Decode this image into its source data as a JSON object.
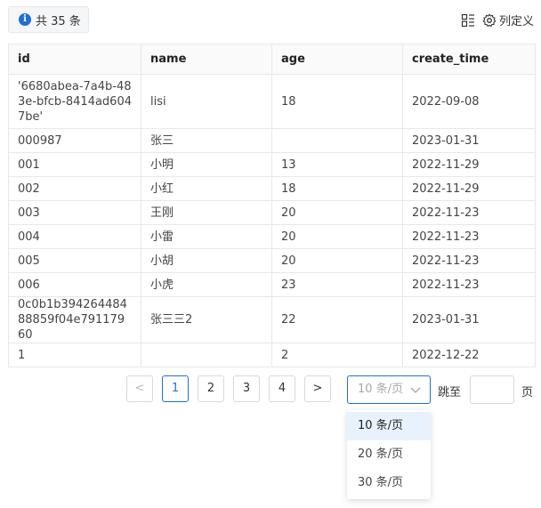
{
  "toolbar": {
    "info_icon_glyph": "i",
    "total_text": "共 35 条",
    "column_settings_label": "列定义"
  },
  "table": {
    "headers": [
      "id",
      "name",
      "age",
      "create_time"
    ],
    "rows": [
      [
        "'6680abea-7a4b-483e-bfcb-8414ad6047be'",
        "lisi",
        "18",
        "2022-09-08"
      ],
      [
        "000987",
        "张三",
        "",
        "2023-01-31"
      ],
      [
        "001",
        "小明",
        "13",
        "2022-11-29"
      ],
      [
        "002",
        "小红",
        "18",
        "2022-11-29"
      ],
      [
        "003",
        "王刚",
        "20",
        "2022-11-23"
      ],
      [
        "004",
        "小雷",
        "20",
        "2022-11-23"
      ],
      [
        "005",
        "小胡",
        "20",
        "2022-11-23"
      ],
      [
        "006",
        "小虎",
        "23",
        "2022-11-23"
      ],
      [
        "0c0b1b39426448488859f04e79117960",
        "张三三2",
        "22",
        "2023-01-31"
      ],
      [
        "1",
        "",
        "2",
        "2022-12-22"
      ]
    ]
  },
  "pagination": {
    "prev_glyph": "<",
    "next_glyph": ">",
    "pages": [
      "1",
      "2",
      "3",
      "4"
    ],
    "current_page": "1",
    "page_size_value": "10 条/页",
    "jump_label": "跳至",
    "jump_value": "",
    "page_unit": "页",
    "page_size_options": [
      "10 条/页",
      "20 条/页",
      "30 条/页"
    ]
  },
  "colors": {
    "accent": "#1f6fd8",
    "border": "#e8e8e8",
    "header_bg": "#fafafa",
    "dropdown_selected_bg": "#e8f2fd"
  },
  "icons": [
    "info-icon",
    "density-icon",
    "settings-gear-icon",
    "chevron-left-icon",
    "chevron-right-icon",
    "chevron-down-icon"
  ]
}
